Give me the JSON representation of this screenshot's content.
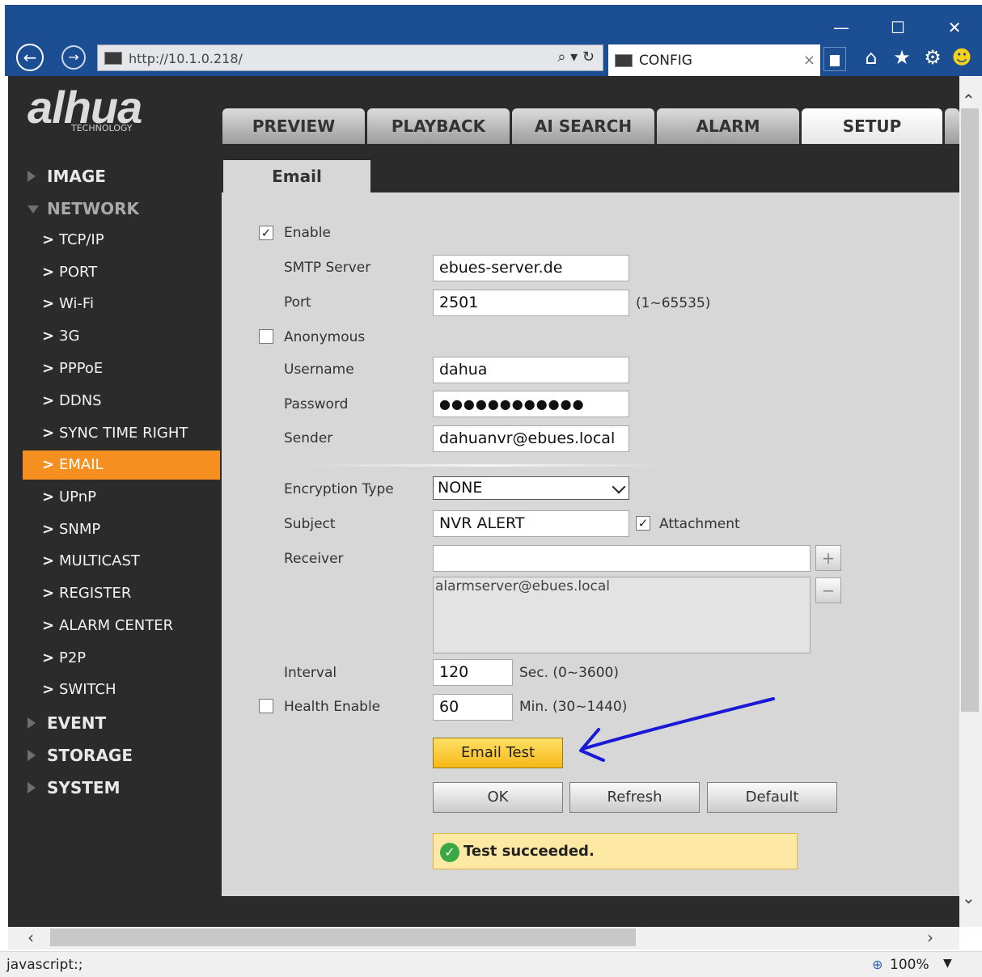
{
  "browser": {
    "url": "http://10.1.0.218/",
    "url_tools": "⌕ ▾ ↻",
    "tab_title": "CONFIG",
    "tab_close": "×",
    "window_controls": {
      "minimize": "—",
      "maximize": "☐",
      "close": "✕"
    },
    "nav": {
      "back": "←",
      "forward": "→"
    },
    "toolbar_icons": [
      "home-icon",
      "favorites-star-icon",
      "settings-gear-icon",
      "smiley-feedback-icon"
    ],
    "status_text": "javascript:;",
    "zoom": "100%"
  },
  "app": {
    "logo_text": "alhua",
    "logo_sub": "TECHNOLOGY",
    "main_tabs": [
      "PREVIEW",
      "PLAYBACK",
      "AI SEARCH",
      "ALARM",
      "SETUP"
    ],
    "active_tab": "SETUP"
  },
  "sidebar": {
    "groups": {
      "image": "IMAGE",
      "network": "NETWORK",
      "event": "EVENT",
      "storage": "STORAGE",
      "system": "SYSTEM"
    },
    "network_items": [
      "TCP/IP",
      "PORT",
      "Wi-Fi",
      "3G",
      "PPPoE",
      "DDNS",
      "SYNC TIME RIGHT",
      "EMAIL",
      "UPnP",
      "SNMP",
      "MULTICAST",
      "REGISTER",
      "ALARM CENTER",
      "P2P",
      "SWITCH"
    ],
    "active_item": "EMAIL"
  },
  "email": {
    "tab_label": "Email",
    "enable_label": "Enable",
    "enable_checked": "✓",
    "smtp_label": "SMTP Server",
    "smtp_value": "ebues-server.de",
    "port_label": "Port",
    "port_value": "2501",
    "port_range": "(1~65535)",
    "anonymous_label": "Anonymous",
    "username_label": "Username",
    "username_value": "dahua",
    "password_label": "Password",
    "password_value": "●●●●●●●●●●●●",
    "sender_label": "Sender",
    "sender_value": "dahuanvr@ebues.local",
    "encryption_label": "Encryption Type",
    "encryption_value": "NONE",
    "subject_label": "Subject",
    "subject_value": "NVR ALERT",
    "attachment_label": "Attachment",
    "attachment_checked": "✓",
    "receiver_label": "Receiver",
    "receiver_input": "",
    "receiver_list": [
      "alarmserver@ebues.local"
    ],
    "add_symbol": "+",
    "remove_symbol": "−",
    "interval_label": "Interval",
    "interval_value": "120",
    "interval_unit": "Sec. (0~3600)",
    "health_label": "Health Enable",
    "health_value": "60",
    "health_unit": "Min. (30~1440)",
    "email_test_button": "Email Test",
    "ok_button": "OK",
    "refresh_button": "Refresh",
    "default_button": "Default",
    "test_message": "Test succeeded.",
    "test_icon": "✓"
  },
  "colors": {
    "accent_orange": "#f58f1f",
    "titlebar_blue": "#1b4e93",
    "annotation_arrow": "#1a1ad6",
    "success_green": "#3aa845"
  }
}
